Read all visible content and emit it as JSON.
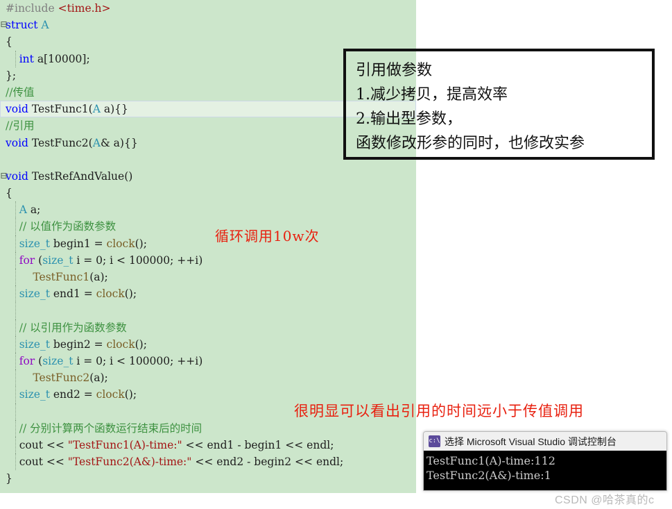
{
  "editor": {
    "background_color": "#cce6cb",
    "highlight_color": "#e4f1e3",
    "lines": [
      {
        "gutter": "",
        "tokens": [
          {
            "t": "#include ",
            "c": "c-pre"
          },
          {
            "t": "<time.h>",
            "c": "c-str"
          }
        ]
      },
      {
        "gutter": "⊟",
        "tokens": [
          {
            "t": "struct ",
            "c": "c-kw"
          },
          {
            "t": "A",
            "c": "c-type"
          }
        ]
      },
      {
        "gutter": "",
        "tokens": [
          {
            "t": "{",
            "c": "c-plain"
          }
        ]
      },
      {
        "gutter": "",
        "guide": true,
        "tokens": [
          {
            "t": "    ",
            "c": "c-plain"
          },
          {
            "t": "int",
            "c": "c-kw"
          },
          {
            "t": " a[",
            "c": "c-plain"
          },
          {
            "t": "10000",
            "c": "c-plain"
          },
          {
            "t": "];",
            "c": "c-plain"
          }
        ]
      },
      {
        "gutter": "",
        "tokens": [
          {
            "t": "};",
            "c": "c-plain"
          }
        ]
      },
      {
        "gutter": "",
        "tokens": [
          {
            "t": "//传值",
            "c": "c-cmt"
          }
        ]
      },
      {
        "gutter": "",
        "highlight": true,
        "tokens": [
          {
            "t": "void",
            "c": "c-kw"
          },
          {
            "t": " ",
            "c": "c-plain"
          },
          {
            "t": "TestFunc1",
            "c": "c-plain"
          },
          {
            "t": "(",
            "c": "c-plain"
          },
          {
            "t": "A",
            "c": "c-type"
          },
          {
            "t": " a",
            "c": "c-plain"
          },
          {
            "t": "){}",
            "c": "c-plain"
          }
        ]
      },
      {
        "gutter": "",
        "tokens": [
          {
            "t": "//引用",
            "c": "c-cmt"
          }
        ]
      },
      {
        "gutter": "",
        "tokens": [
          {
            "t": "void",
            "c": "c-kw"
          },
          {
            "t": " ",
            "c": "c-plain"
          },
          {
            "t": "TestFunc2",
            "c": "c-plain"
          },
          {
            "t": "(",
            "c": "c-plain"
          },
          {
            "t": "A",
            "c": "c-type"
          },
          {
            "t": "& a",
            "c": "c-plain"
          },
          {
            "t": "){}",
            "c": "c-plain"
          }
        ]
      },
      {
        "gutter": "",
        "tokens": [
          {
            "t": "",
            "c": "c-plain"
          }
        ]
      },
      {
        "gutter": "⊟",
        "tokens": [
          {
            "t": "void",
            "c": "c-kw"
          },
          {
            "t": " ",
            "c": "c-plain"
          },
          {
            "t": "TestRefAndValue",
            "c": "c-plain"
          },
          {
            "t": "()",
            "c": "c-plain"
          }
        ]
      },
      {
        "gutter": "",
        "tokens": [
          {
            "t": "{",
            "c": "c-plain"
          }
        ]
      },
      {
        "gutter": "",
        "guide": true,
        "tokens": [
          {
            "t": "    ",
            "c": "c-plain"
          },
          {
            "t": "A",
            "c": "c-type"
          },
          {
            "t": " a;",
            "c": "c-plain"
          }
        ]
      },
      {
        "gutter": "",
        "guide": true,
        "tokens": [
          {
            "t": "    ",
            "c": "c-plain"
          },
          {
            "t": "// 以值作为函数参数",
            "c": "c-cmt"
          }
        ]
      },
      {
        "gutter": "",
        "guide": true,
        "tokens": [
          {
            "t": "    ",
            "c": "c-plain"
          },
          {
            "t": "size_t",
            "c": "c-type"
          },
          {
            "t": " begin1 = ",
            "c": "c-plain"
          },
          {
            "t": "clock",
            "c": "c-fn"
          },
          {
            "t": "();",
            "c": "c-plain"
          }
        ]
      },
      {
        "gutter": "",
        "guide": true,
        "tokens": [
          {
            "t": "    ",
            "c": "c-plain"
          },
          {
            "t": "for",
            "c": "c-kw2"
          },
          {
            "t": " (",
            "c": "c-plain"
          },
          {
            "t": "size_t",
            "c": "c-type"
          },
          {
            "t": " i = 0; i < 100000; ++i)",
            "c": "c-plain"
          }
        ]
      },
      {
        "gutter": "",
        "guide": true,
        "tokens": [
          {
            "t": "        ",
            "c": "c-plain"
          },
          {
            "t": "TestFunc1",
            "c": "c-fn"
          },
          {
            "t": "(a);",
            "c": "c-plain"
          }
        ]
      },
      {
        "gutter": "",
        "guide": true,
        "tokens": [
          {
            "t": "    ",
            "c": "c-plain"
          },
          {
            "t": "size_t",
            "c": "c-type"
          },
          {
            "t": " end1 = ",
            "c": "c-plain"
          },
          {
            "t": "clock",
            "c": "c-fn"
          },
          {
            "t": "();",
            "c": "c-plain"
          }
        ]
      },
      {
        "gutter": "",
        "guide": true,
        "tokens": [
          {
            "t": "",
            "c": "c-plain"
          }
        ]
      },
      {
        "gutter": "",
        "guide": true,
        "tokens": [
          {
            "t": "    ",
            "c": "c-plain"
          },
          {
            "t": "// 以引用作为函数参数",
            "c": "c-cmt"
          }
        ]
      },
      {
        "gutter": "",
        "guide": true,
        "tokens": [
          {
            "t": "    ",
            "c": "c-plain"
          },
          {
            "t": "size_t",
            "c": "c-type"
          },
          {
            "t": " begin2 = ",
            "c": "c-plain"
          },
          {
            "t": "clock",
            "c": "c-fn"
          },
          {
            "t": "();",
            "c": "c-plain"
          }
        ]
      },
      {
        "gutter": "",
        "guide": true,
        "tokens": [
          {
            "t": "    ",
            "c": "c-plain"
          },
          {
            "t": "for",
            "c": "c-kw2"
          },
          {
            "t": " (",
            "c": "c-plain"
          },
          {
            "t": "size_t",
            "c": "c-type"
          },
          {
            "t": " i = 0; i < 100000; ++i)",
            "c": "c-plain"
          }
        ]
      },
      {
        "gutter": "",
        "guide": true,
        "tokens": [
          {
            "t": "        ",
            "c": "c-plain"
          },
          {
            "t": "TestFunc2",
            "c": "c-fn"
          },
          {
            "t": "(a);",
            "c": "c-plain"
          }
        ]
      },
      {
        "gutter": "",
        "guide": true,
        "tokens": [
          {
            "t": "    ",
            "c": "c-plain"
          },
          {
            "t": "size_t",
            "c": "c-type"
          },
          {
            "t": " end2 = ",
            "c": "c-plain"
          },
          {
            "t": "clock",
            "c": "c-fn"
          },
          {
            "t": "();",
            "c": "c-plain"
          }
        ]
      },
      {
        "gutter": "",
        "guide": true,
        "tokens": [
          {
            "t": "",
            "c": "c-plain"
          }
        ]
      },
      {
        "gutter": "",
        "guide": true,
        "tokens": [
          {
            "t": "    ",
            "c": "c-plain"
          },
          {
            "t": "// 分别计算两个函数运行结束后的时间",
            "c": "c-cmt"
          }
        ]
      },
      {
        "gutter": "",
        "guide": true,
        "tokens": [
          {
            "t": "    ",
            "c": "c-plain"
          },
          {
            "t": "cout",
            "c": "c-plain"
          },
          {
            "t": " << ",
            "c": "c-plain"
          },
          {
            "t": "\"TestFunc1(A)-time:\"",
            "c": "c-str"
          },
          {
            "t": " << ",
            "c": "c-plain"
          },
          {
            "t": "end1 - begin1",
            "c": "c-plain"
          },
          {
            "t": " << ",
            "c": "c-plain"
          },
          {
            "t": "endl;",
            "c": "c-plain"
          }
        ]
      },
      {
        "gutter": "",
        "guide": true,
        "tokens": [
          {
            "t": "    ",
            "c": "c-plain"
          },
          {
            "t": "cout",
            "c": "c-plain"
          },
          {
            "t": " << ",
            "c": "c-plain"
          },
          {
            "t": "\"TestFunc2(A&)-time:\"",
            "c": "c-str"
          },
          {
            "t": " << ",
            "c": "c-plain"
          },
          {
            "t": "end2 - begin2",
            "c": "c-plain"
          },
          {
            "t": " << ",
            "c": "c-plain"
          },
          {
            "t": "endl;",
            "c": "c-plain"
          }
        ]
      },
      {
        "gutter": "",
        "tokens": [
          {
            "t": "}",
            "c": "c-plain"
          }
        ]
      }
    ]
  },
  "callout": {
    "border_color": "#111111",
    "lines": [
      "引用做参数",
      "1.减少拷贝，提高效率",
      "2.输出型参数，",
      "函数修改形参的同时，也修改实参"
    ]
  },
  "annotations": {
    "color": "#e8200f",
    "loop_note": "循环调用10w次",
    "conclusion_note": "很明显可以看出引用的时间远小于传值调用"
  },
  "console": {
    "title": "选择 Microsoft Visual Studio 调试控制台",
    "icon_label": "c:\\",
    "output_lines": [
      "TestFunc1(A)-time:112",
      "TestFunc2(A&)-time:1"
    ]
  },
  "watermark": {
    "text": "CSDN @哈茶真的c"
  }
}
